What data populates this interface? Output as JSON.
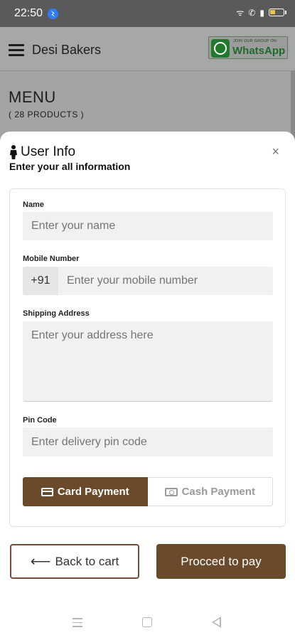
{
  "status_bar": {
    "time": "22:50",
    "icons": [
      "notification-icon",
      "wifi-icon",
      "volte-icon",
      "signal-icon",
      "battery-icon"
    ]
  },
  "app_header": {
    "title": "Desi Bakers",
    "whatsapp_small": "JOIN OUR GROUP ON",
    "whatsapp_label": "WhatsApp"
  },
  "menu": {
    "title": "MENU",
    "subtitle": "( 28 PRODUCTS )"
  },
  "user_info": {
    "title": "User Info",
    "subtitle": "Enter your all information",
    "close_symbol": "×"
  },
  "form": {
    "name_label": "Name",
    "name_placeholder": "Enter your name",
    "mobile_label": "Mobile Number",
    "mobile_prefix": "+91",
    "mobile_placeholder": "Enter your mobile number",
    "address_label": "Shipping Address",
    "address_placeholder": "Enter your address here",
    "pin_label": "Pin Code",
    "pin_placeholder": "Enter delivery pin code"
  },
  "payment": {
    "card_label": "Card Payment",
    "cash_label": "Cash Payment",
    "selected": "card"
  },
  "actions": {
    "back_label": "Back to cart",
    "back_arrow": "⟵",
    "pay_label": "Procced to pay"
  },
  "colors": {
    "brand_brown": "#6b4a2b",
    "back_border": "#7a4a3a"
  }
}
